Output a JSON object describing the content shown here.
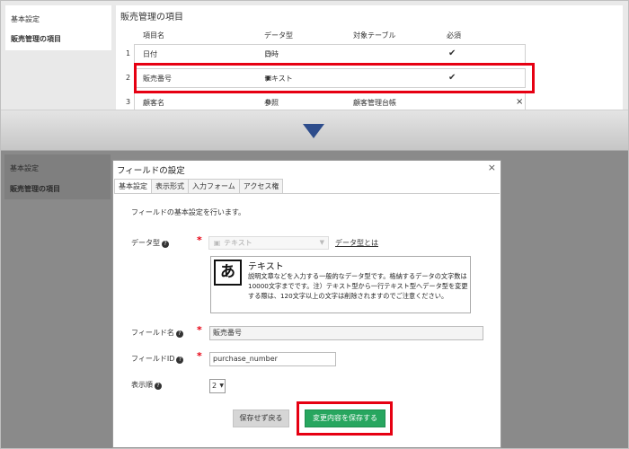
{
  "sidebar": {
    "items": [
      {
        "label": "基本設定"
      },
      {
        "label": "販売管理の項目"
      }
    ]
  },
  "main": {
    "title": "販売管理の項目",
    "columns": {
      "name": "項目名",
      "type": "データ型",
      "table": "対象テーブル",
      "required": "必須"
    },
    "rows": [
      {
        "num": "1",
        "name": "日付",
        "type": "日時",
        "type_icon": "clock-icon",
        "table": "",
        "required": "✔"
      },
      {
        "num": "2",
        "name": "販売番号",
        "type": "テキスト",
        "type_icon": "text-icon",
        "table": "",
        "required": "✔"
      },
      {
        "num": "3",
        "name": "顧客名",
        "type": "参照",
        "type_icon": "link-icon",
        "table": "顧客管理台帳",
        "required": "×"
      }
    ]
  },
  "modal": {
    "title": "フィールドの設定",
    "close": "×",
    "tabs": [
      {
        "label": "基本設定"
      },
      {
        "label": "表示形式"
      },
      {
        "label": "入力フォーム"
      },
      {
        "label": "アクセス権"
      }
    ],
    "intro": "フィールドの基本設定を行います。",
    "data_type": {
      "label": "データ型",
      "value": "テキスト",
      "link": "データ型とは"
    },
    "description": {
      "icon": "あ",
      "title": "テキスト",
      "text": "説明文章などを入力する一般的なデータ型です。格納するデータの文字数は10000文字までです。注）テキスト型から一行テキスト型へデータ型を変更する際は、120文字以上の文字は削除されますのでご注意ください。"
    },
    "field_name": {
      "label": "フィールド名",
      "value": "販売番号"
    },
    "field_id": {
      "label": "フィールドID",
      "value": "purchase_number"
    },
    "display_order": {
      "label": "表示順",
      "value": "2"
    },
    "buttons": {
      "back": "保存せず戻る",
      "save": "変更内容を保存する"
    }
  },
  "colors": {
    "highlight": "#e60012",
    "save_button": "#27a65f",
    "arrow": "#2e4d8c"
  }
}
